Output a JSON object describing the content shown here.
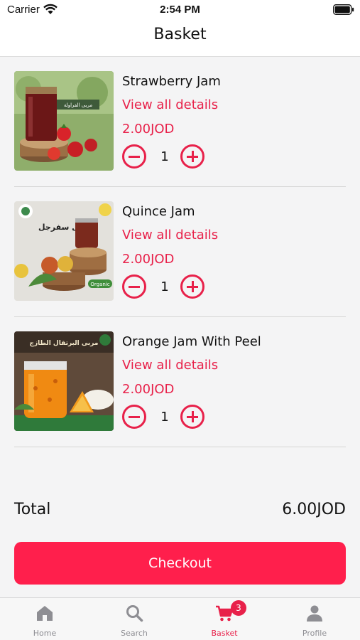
{
  "status_bar": {
    "carrier": "Carrier",
    "time": "2:54 PM"
  },
  "nav": {
    "title": "Basket"
  },
  "items": [
    {
      "name": "Strawberry Jam",
      "details_link": "View all details",
      "price": "2.00JOD",
      "quantity": "1",
      "thumb_icon": "strawberry-jam-image",
      "thumb_caption": "مربى الفراولة"
    },
    {
      "name": "Quince Jam",
      "details_link": "View all details",
      "price": "2.00JOD",
      "quantity": "1",
      "thumb_icon": "quince-jam-image",
      "thumb_caption": "مربى سفرجل",
      "thumb_tag": "Organic"
    },
    {
      "name": "Orange Jam With Peel",
      "details_link": "View all details",
      "price": "2.00JOD",
      "quantity": "1",
      "thumb_icon": "orange-jam-image",
      "thumb_caption": "مربى البرتقال الطازج"
    }
  ],
  "total": {
    "label": "Total",
    "value": "6.00JOD"
  },
  "checkout": {
    "label": "Checkout"
  },
  "tab_bar": {
    "tabs": [
      {
        "label": "Home",
        "icon": "home-icon",
        "active": false
      },
      {
        "label": "Search",
        "icon": "search-icon",
        "active": false
      },
      {
        "label": "Basket",
        "icon": "cart-icon",
        "active": true,
        "badge": "3"
      },
      {
        "label": "Profile",
        "icon": "profile-icon",
        "active": false
      }
    ]
  },
  "colors": {
    "accent": "#e8214a",
    "button": "#ff1f4c",
    "background": "#f4f4f5"
  }
}
